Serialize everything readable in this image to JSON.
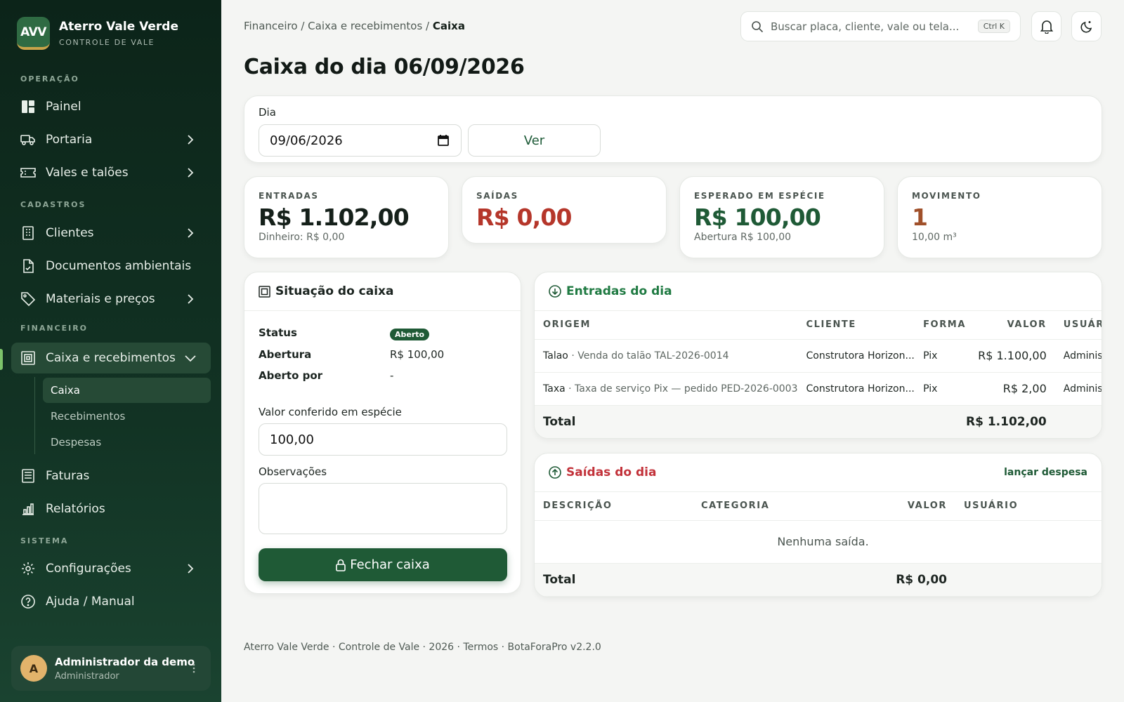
{
  "brand": {
    "logo": "AVV",
    "title": "Aterro Vale Verde",
    "subtitle": "CONTROLE DE VALE"
  },
  "sidebar": {
    "sections": [
      "OPERAÇÃO",
      "CADASTROS",
      "FINANCEIRO",
      "SISTEMA"
    ],
    "items": [
      {
        "label": "Painel",
        "icon": "dashboard-icon"
      },
      {
        "label": "Portaria",
        "icon": "truck-icon"
      },
      {
        "label": "Vales e talões",
        "icon": "ticket-icon"
      },
      {
        "label": "Clientes",
        "icon": "building-icon"
      },
      {
        "label": "Documentos ambientais",
        "icon": "document-icon"
      },
      {
        "label": "Materiais e preços",
        "icon": "tag-icon"
      },
      {
        "label": "Caixa e recebimentos",
        "icon": "cash-register-icon"
      },
      {
        "label": "Faturas",
        "icon": "invoice-icon"
      },
      {
        "label": "Relatórios",
        "icon": "bar-chart-icon"
      },
      {
        "label": "Configurações",
        "icon": "gear-icon"
      },
      {
        "label": "Ajuda / Manual",
        "icon": "help-icon"
      }
    ],
    "subitems": [
      "Caixa",
      "Recebimentos",
      "Despesas"
    ]
  },
  "user": {
    "initial": "A",
    "name": "Administrador da demo",
    "role": "Administrador"
  },
  "breadcrumb": {
    "path": "Financeiro / Caixa e recebimentos / ",
    "current": "Caixa"
  },
  "search": {
    "placeholder": "Buscar placa, cliente, vale ou tela...",
    "shortcut": "Ctrl K"
  },
  "page": {
    "title": "Caixa do dia 06/09/2026"
  },
  "filter": {
    "label": "Dia",
    "date": "09/06/2026",
    "button": "Ver"
  },
  "stats": [
    {
      "label": "ENTRADAS",
      "value": "R$ 1.102,00",
      "sub": "Dinheiro: R$ 0,00",
      "color": "#15201a"
    },
    {
      "label": "SAÍDAS",
      "value": "R$ 0,00",
      "sub": "",
      "color": "#b5362a"
    },
    {
      "label": "ESPERADO EM ESPÉCIE",
      "value": "R$ 100,00",
      "sub": "Abertura R$ 100,00",
      "color": "#1f5a36"
    },
    {
      "label": "MOVIMENTO",
      "value": "1",
      "sub": "10,00 m³",
      "color": "#a0502a"
    }
  ],
  "situacao": {
    "title": "Situação do caixa",
    "rows": [
      {
        "k": "Status",
        "v": "Aberto"
      },
      {
        "k": "Abertura",
        "v": "R$ 100,00"
      },
      {
        "k": "Aberto por",
        "v": "-"
      }
    ],
    "conferido_label": "Valor conferido em espécie",
    "conferido_value": "100,00",
    "obs_label": "Observações",
    "button": "Fechar caixa"
  },
  "entradas": {
    "title": "Entradas do dia",
    "columns": [
      "ORIGEM",
      "CLIENTE",
      "FORMA",
      "VALOR",
      "USUÁRIO"
    ],
    "rows": [
      {
        "origem": "Talao",
        "detalhe": "Venda do talão TAL-2026-0014",
        "cliente": "Construtora Horizon...",
        "forma": "Pix",
        "valor": "R$ 1.100,00",
        "usuario": "Administ"
      },
      {
        "origem": "Taxa",
        "detalhe": "Taxa de serviço Pix — pedido PED-2026-0003",
        "cliente": "Construtora Horizon...",
        "forma": "Pix",
        "valor": "R$ 2,00",
        "usuario": "Administ"
      }
    ],
    "total_label": "Total",
    "total": "R$ 1.102,00"
  },
  "saidas": {
    "title": "Saídas do dia",
    "action": "lançar despesa",
    "columns": [
      "DESCRIÇÃO",
      "CATEGORIA",
      "VALOR",
      "USUÁRIO"
    ],
    "empty": "Nenhuma saída.",
    "total_label": "Total",
    "total": "R$ 0,00"
  },
  "footer": "Aterro Vale Verde · Controle de Vale · 2026 · Termos · BotaForaPro v2.2.0",
  "colors": {
    "primary": "#1f5a36",
    "sidebar": "#0c2419",
    "danger": "#b5362a",
    "accent": "#7cc36a"
  }
}
